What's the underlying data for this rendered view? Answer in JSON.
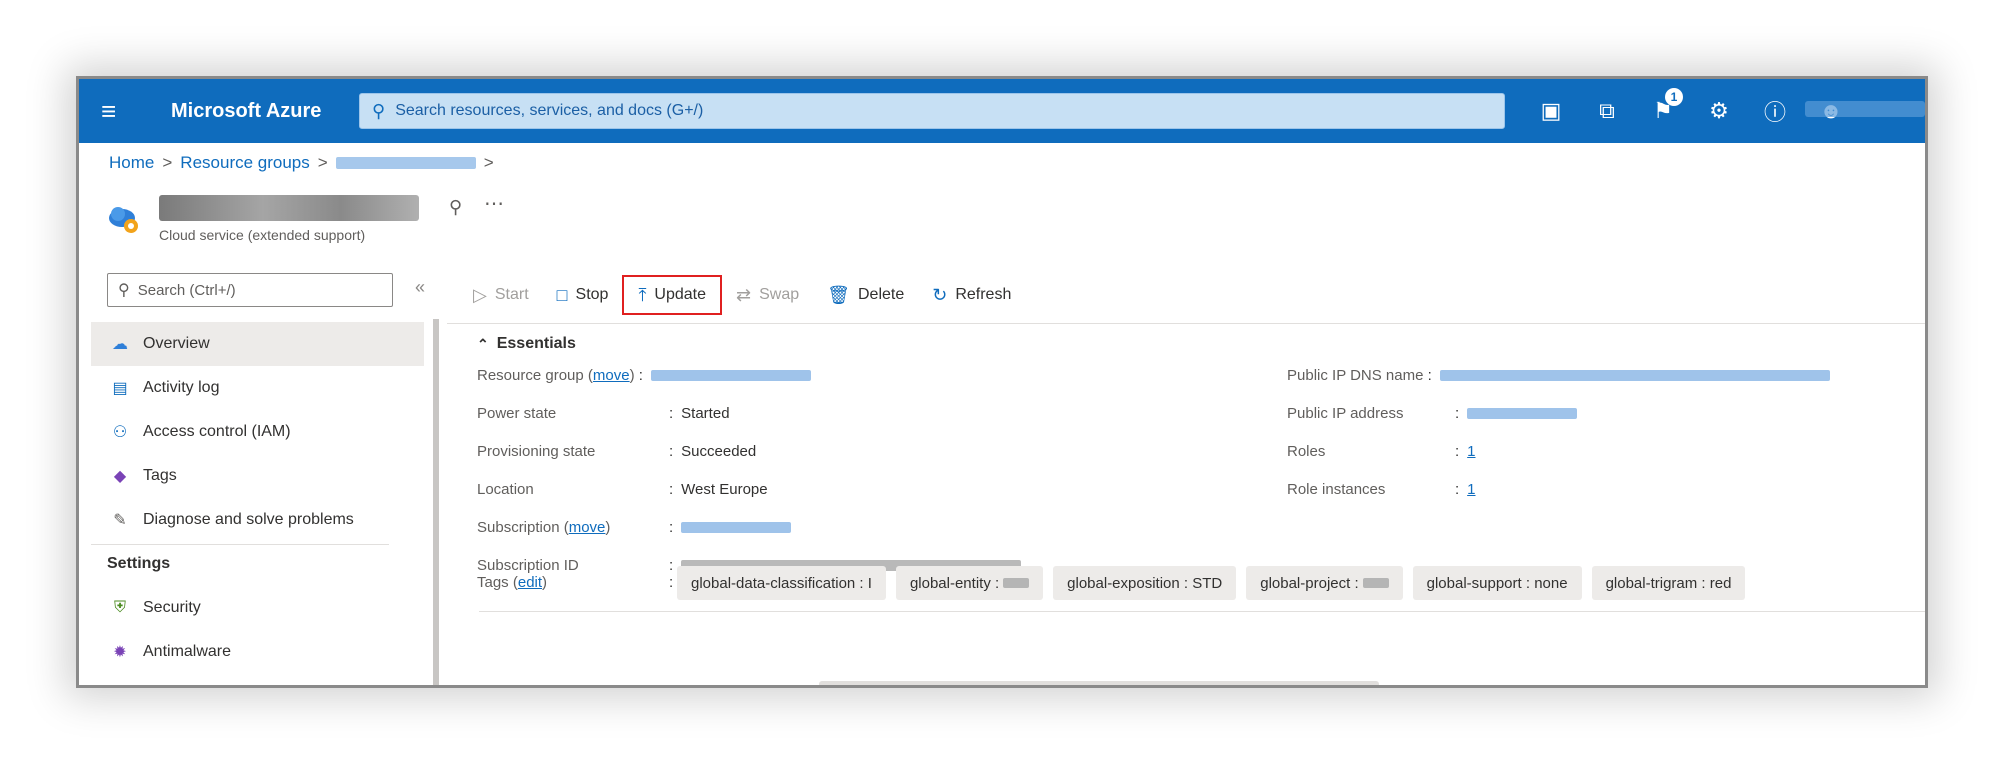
{
  "topbar": {
    "brand": "Microsoft Azure",
    "search_placeholder": "Search resources, services, and docs (G+/)",
    "notification_count": "1"
  },
  "breadcrumb": {
    "items": [
      "Home",
      "Resource groups"
    ]
  },
  "resource": {
    "subtitle": "Cloud service (extended support)"
  },
  "sidebar": {
    "search_placeholder": "Search (Ctrl+/)",
    "items": [
      {
        "label": "Overview",
        "icon": "overview-icon"
      },
      {
        "label": "Activity log",
        "icon": "activity-log-icon"
      },
      {
        "label": "Access control (IAM)",
        "icon": "iam-icon"
      },
      {
        "label": "Tags",
        "icon": "tag-icon"
      },
      {
        "label": "Diagnose and solve problems",
        "icon": "wrench-icon"
      }
    ],
    "section_settings": "Settings",
    "settings_items": [
      {
        "label": "Security",
        "icon": "shield-icon"
      },
      {
        "label": "Antimalware",
        "icon": "antimalware-icon"
      }
    ]
  },
  "toolbar": {
    "start": "Start",
    "stop": "Stop",
    "update": "Update",
    "swap": "Swap",
    "delete": "Delete",
    "refresh": "Refresh"
  },
  "essentials": {
    "title": "Essentials",
    "left": {
      "resource_group_label": "Resource group",
      "move": "move",
      "power_state_label": "Power state",
      "power_state_value": "Started",
      "provisioning_state_label": "Provisioning state",
      "provisioning_state_value": "Succeeded",
      "location_label": "Location",
      "location_value": "West Europe",
      "subscription_label": "Subscription",
      "subscription_id_label": "Subscription ID",
      "tags_label": "Tags",
      "edit": "edit"
    },
    "right": {
      "dns_label": "Public IP DNS name",
      "ip_label": "Public IP address",
      "roles_label": "Roles",
      "roles_value": "1",
      "instances_label": "Role instances",
      "instances_value": "1"
    },
    "tags": [
      {
        "text": "global-data-classification : I",
        "redacted": false
      },
      {
        "text": "global-entity :",
        "redacted": true
      },
      {
        "text": "global-exposition : STD",
        "redacted": false
      },
      {
        "text": "global-project :",
        "redacted": true
      },
      {
        "text": "global-support : none",
        "redacted": false
      },
      {
        "text": "global-trigram : red",
        "redacted": false
      }
    ]
  },
  "colors": {
    "azure_blue": "#0f6cbd",
    "highlight_red": "#e02020"
  }
}
